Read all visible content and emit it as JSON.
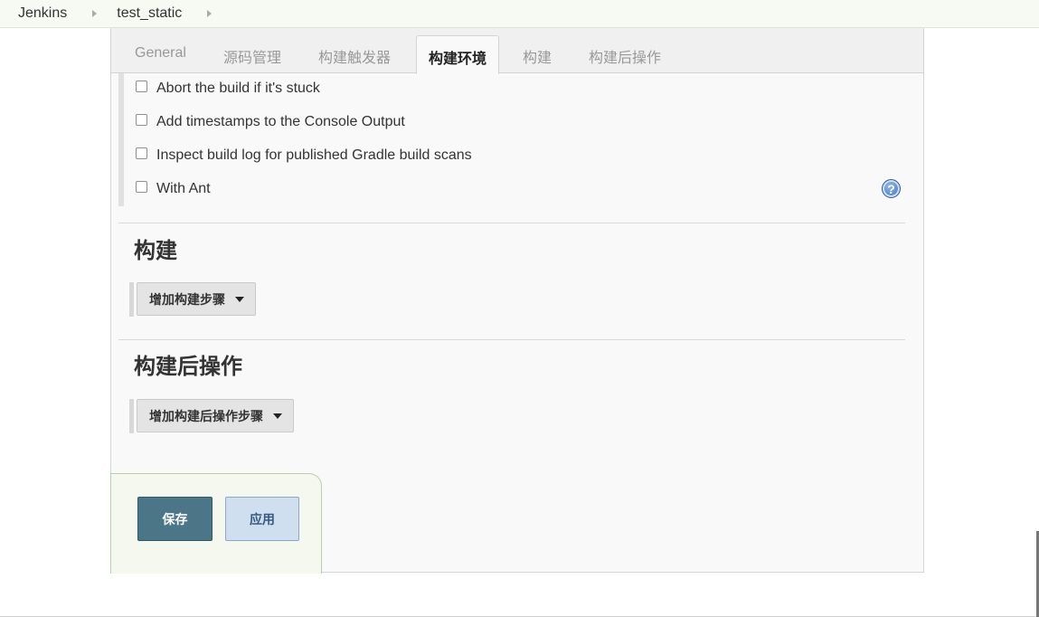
{
  "breadcrumb": {
    "items": [
      "Jenkins",
      "test_static"
    ]
  },
  "tabs": [
    "General",
    "源码管理",
    "构建触发器",
    "构建环境",
    "构建",
    "构建后操作"
  ],
  "active_tab": "构建环境",
  "build_env_options": [
    {
      "label": "Abort the build if it's stuck",
      "checked": false
    },
    {
      "label": "Add timestamps to the Console Output",
      "checked": false
    },
    {
      "label": "Inspect build log for published Gradle build scans",
      "checked": false
    },
    {
      "label": "With Ant",
      "checked": false
    }
  ],
  "help_icon": {
    "glyph": "?",
    "icon": "help-icon"
  },
  "build_section": {
    "title": "构建",
    "add_button": "增加构建步骤"
  },
  "post_build_section": {
    "title": "构建后操作",
    "add_button": "增加构建后操作步骤"
  },
  "actions": {
    "save": "保存",
    "apply": "应用"
  },
  "colors": {
    "save_bg": "#4a7687",
    "apply_bg": "#cfdff0",
    "help_icon": "#3c73b8",
    "breadcrumb_bg": "#f7faf3"
  }
}
